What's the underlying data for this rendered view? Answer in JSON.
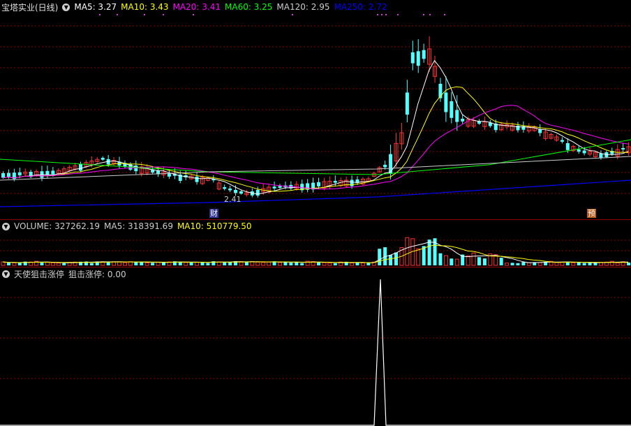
{
  "main": {
    "title": "宝塔实业(日线)",
    "ma_items": [
      {
        "label": "MA5: 3.27",
        "color": "#ffffff"
      },
      {
        "label": "MA10: 3.43",
        "color": "#ffff00"
      },
      {
        "label": "MA20: 3.41",
        "color": "#ff00ff"
      },
      {
        "label": "MA60: 3.25",
        "color": "#00ff00"
      },
      {
        "label": "MA120: 2.95",
        "color": "#cccccc"
      },
      {
        "label": "MA250: 2.72",
        "color": "#0000ff"
      }
    ],
    "low_label": "2.41",
    "marker_cai": "财",
    "marker_yu": "预"
  },
  "volume": {
    "items": [
      {
        "label": "VOLUME: 327262.19",
        "color": "#cccccc"
      },
      {
        "label": "MA5: 318391.69",
        "color": "#cccccc"
      },
      {
        "label": "MA10: 510779.50",
        "color": "#ffff00"
      }
    ]
  },
  "indicator": {
    "name": "天使狙击涨停",
    "value_label": "狙击涨停: 0.00"
  },
  "colors": {
    "up": "#ff3232",
    "down": "#54ffff",
    "grid": "#8b0000",
    "ma5": "#ffffff",
    "ma10": "#ffff00",
    "ma20": "#ff00ff",
    "ma60": "#00ff00",
    "ma120": "#cccccc",
    "ma250": "#0000ff"
  }
}
